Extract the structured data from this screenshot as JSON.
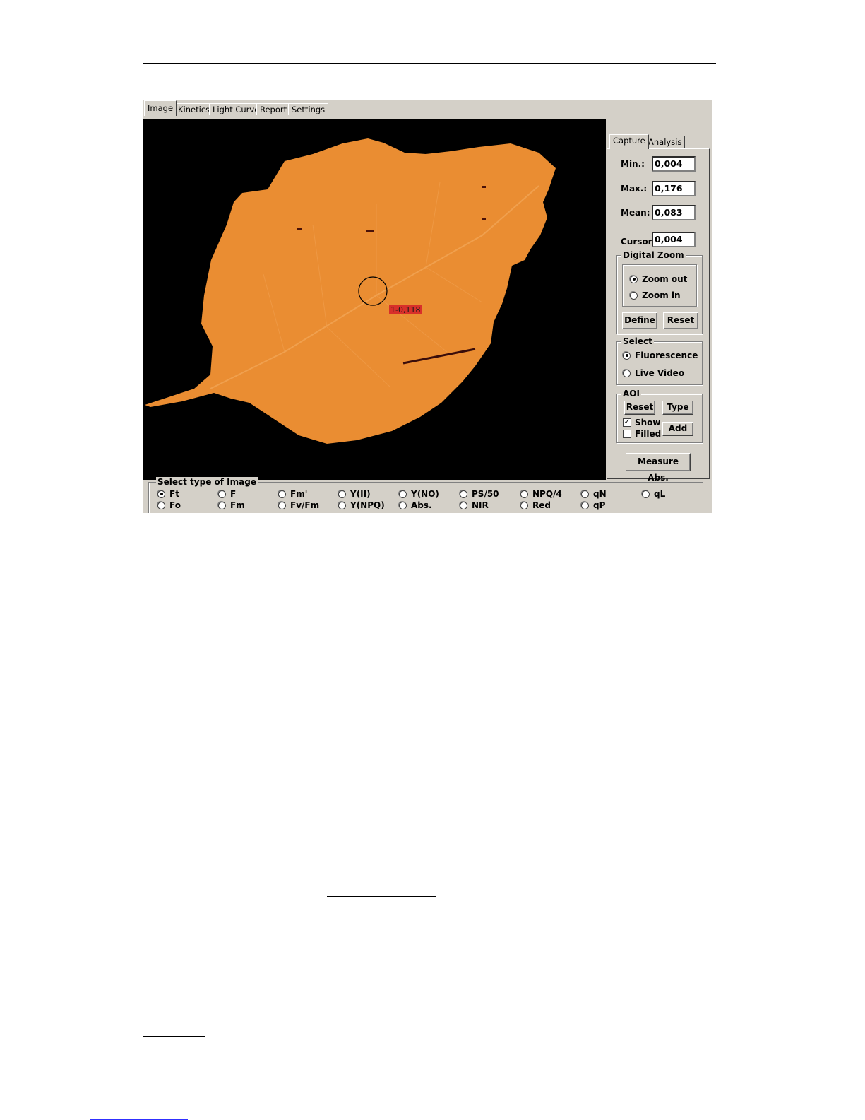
{
  "tabs": [
    "Image",
    "Kinetics",
    "Light Curve",
    "Report",
    "Settings"
  ],
  "side_tabs": [
    "Capture",
    "Analysis"
  ],
  "stats": {
    "min_label": "Min.:",
    "min_value": "0,004",
    "max_label": "Max.:",
    "max_value": "0,176",
    "mean_label": "Mean:",
    "mean_value": "0,083",
    "cursor_label": "Cursor:",
    "cursor_value": "0,004"
  },
  "digital_zoom": {
    "title": "Digital Zoom",
    "zoom_out": "Zoom out",
    "zoom_in": "Zoom in",
    "selected": "Zoom out",
    "define": "Define",
    "reset": "Reset"
  },
  "select_group": {
    "title": "Select",
    "fluorescence": "Fluorescence",
    "live_video": "Live Video",
    "selected": "Fluorescence"
  },
  "aoi": {
    "title": "AOI",
    "reset": "Reset",
    "type": "Type",
    "show": "Show",
    "show_checked": true,
    "filled": "Filled",
    "filled_checked": false,
    "add": "Add"
  },
  "measure_button": "Measure Abs.",
  "aoi_marker_label": "1-0,118",
  "image_type": {
    "title": "Select type of Image",
    "selected": "Ft",
    "row1": [
      "Ft",
      "F",
      "Fm'",
      "Y(II)",
      "Y(NO)",
      "PS/50",
      "NPQ/4",
      "qN",
      "qL"
    ],
    "row2": [
      "Fo",
      "Fm",
      "Fv/Fm",
      "Y(NPQ)",
      "Abs.",
      "NIR",
      "Red",
      "qP"
    ]
  },
  "colors": {
    "leaf": "#ea8d32",
    "window": "#d4d0c8",
    "canvas": "#000000"
  }
}
